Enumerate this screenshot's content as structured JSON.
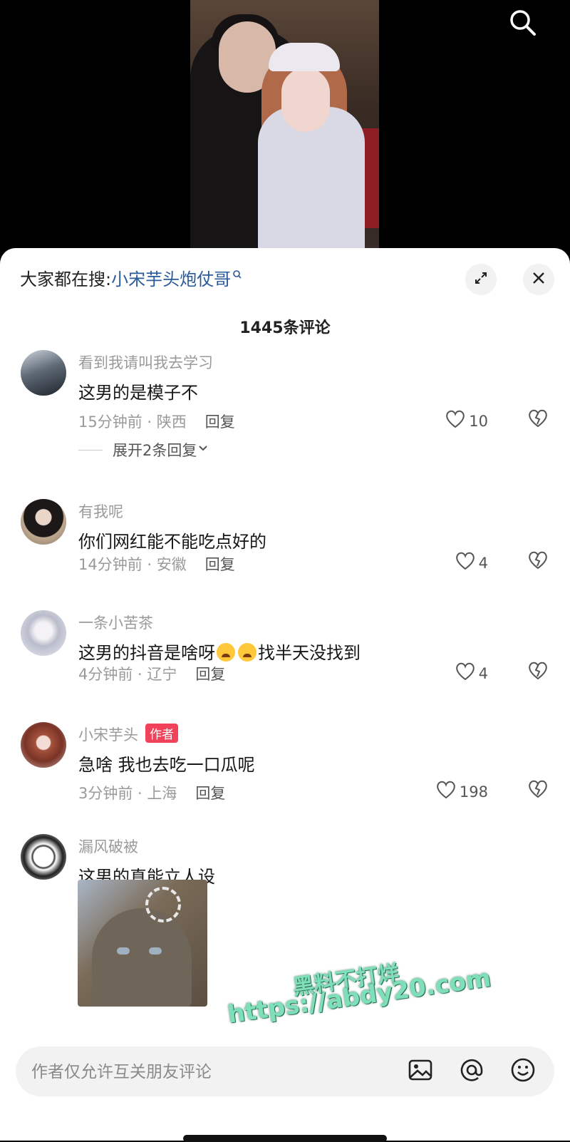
{
  "video": {
    "search_icon": "search-icon"
  },
  "header": {
    "hot_search_prefix": "大家都在搜:",
    "hot_search_keyword": "小宋芋头炮仗哥",
    "expand_icon": "expand-icon",
    "close_icon": "close-icon"
  },
  "comment_count": "1445条评论",
  "comments": [
    {
      "name": "看到我请叫我去学习",
      "text": "这男的是模子不",
      "time_loc": "15分钟前 · 陕西",
      "reply": "回复",
      "likes": "10",
      "expand": "展开2条回复"
    },
    {
      "name": "有我呢",
      "text": "你们网红能不能吃点好的",
      "time_loc": "14分钟前 · 安徽",
      "reply": "回复",
      "likes": "4"
    },
    {
      "name": "一条小苦茶",
      "text_before": "这男的抖音是啥呀",
      "text_after": "找半天没找到",
      "time_loc": "4分钟前 · 辽宁",
      "reply": "回复",
      "likes": "4",
      "emoji": "crying-face-emoji"
    },
    {
      "name": "小宋芋头",
      "badge": "作者",
      "text": "急啥 我也去吃一口瓜呢",
      "time_loc": "3分钟前 · 上海",
      "reply": "回复",
      "likes": "198"
    },
    {
      "name": "漏风破被",
      "text": "这男的真能立人设"
    }
  ],
  "watermark": {
    "line1": "黑料不打烊",
    "line2": "https://abdy20.com"
  },
  "input": {
    "placeholder": "作者仅允许互关朋友评论"
  },
  "colors": {
    "keyword": "#2a5a9a",
    "badge": "#f0435a",
    "sheet": "#ffffff",
    "watermark": "#7ee0b8"
  }
}
